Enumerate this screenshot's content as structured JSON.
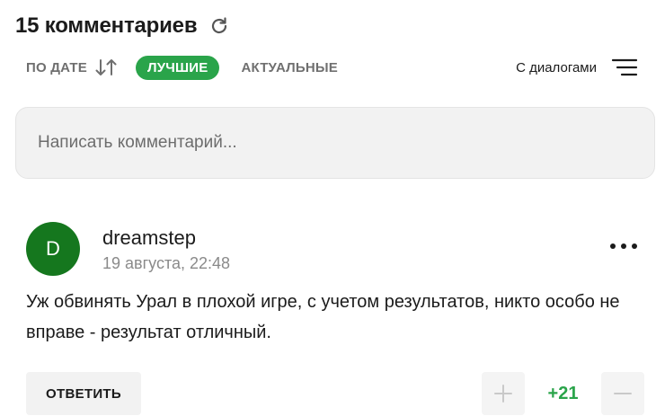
{
  "header": {
    "title": "15 комментариев"
  },
  "sort": {
    "by_date_label": "ПО ДАТЕ",
    "best_label": "ЛУЧШИЕ",
    "actual_label": "АКТУАЛЬНЫЕ",
    "dialogs_label": "С диалогами",
    "active": "ЛУЧШИЕ"
  },
  "input": {
    "placeholder": "Написать комментарий..."
  },
  "comment": {
    "avatar_letter": "D",
    "author": "dreamstep",
    "date": "19 августа, 22:48",
    "text": "Уж обвинять Урал в плохой игре, с учетом результатов, никто особо не вправе - результат отличный.",
    "reply_label": "ОТВЕТИТЬ",
    "score": "+21"
  },
  "colors": {
    "accent_green": "#2aa44a",
    "avatar_green": "#15771e",
    "input_bg": "#f2f2f2"
  },
  "icons": {
    "refresh": "refresh-icon",
    "sort_arrows": "sort-arrows-icon",
    "menu": "filter-menu-icon",
    "more": "more-dots-icon",
    "plus": "plus-icon",
    "minus": "minus-icon"
  }
}
